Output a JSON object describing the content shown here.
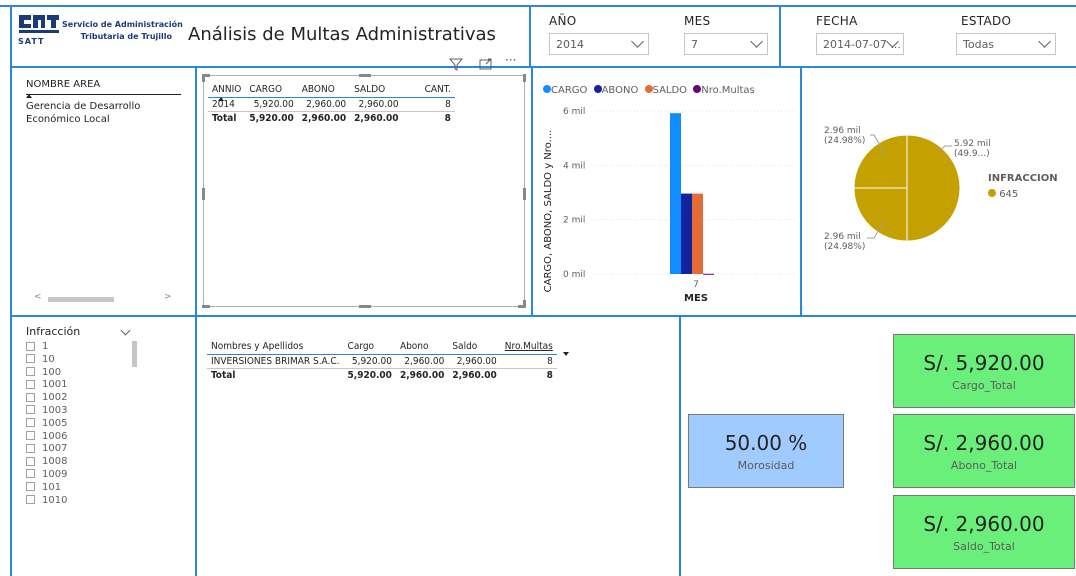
{
  "header": {
    "logo_letters": "SATT",
    "org_line1": "Servicio de Administración",
    "org_line2": "Tributaria de Trujillo",
    "title": "Análisis de Multas Administrativas"
  },
  "filters": [
    {
      "label": "AÑO",
      "value": "2014"
    },
    {
      "label": "MES",
      "value": "7"
    },
    {
      "label": "FECHA",
      "value": "2014-07-07 ..."
    },
    {
      "label": "ESTADO",
      "value": "Todas"
    }
  ],
  "area_slicer": {
    "header": "NOMBRE AREA",
    "items": [
      "Gerencia de Desarrollo Económico Local"
    ]
  },
  "summary_table": {
    "columns": [
      "ANNIO",
      "CARGO",
      "ABONO",
      "SALDO",
      "CANT."
    ],
    "rows": [
      [
        "2014",
        "5,920.00",
        "2,960.00",
        "2,960.00",
        "8"
      ]
    ],
    "total": [
      "Total",
      "5,920.00",
      "2,960.00",
      "2,960.00",
      "8"
    ]
  },
  "chart_data": [
    {
      "type": "bar",
      "legend": [
        "CARGO",
        "ABONO",
        "SALDO",
        "Nro.Multas"
      ],
      "ylabel": "CARGO, ABONO, SALDO y Nro....",
      "xlabel": "MES",
      "categories": [
        "7"
      ],
      "yticks": [
        "0 mil",
        "2 mil",
        "4 mil",
        "6 mil"
      ],
      "ylim": [
        0,
        6000
      ],
      "series": [
        {
          "name": "CARGO",
          "values": [
            5920
          ],
          "color": "#118dff"
        },
        {
          "name": "ABONO",
          "values": [
            2960
          ],
          "color": "#12239e"
        },
        {
          "name": "SALDO",
          "values": [
            2960
          ],
          "color": "#e66c37"
        },
        {
          "name": "Nro.Multas",
          "values": [
            8
          ],
          "color": "#6b007b"
        }
      ]
    },
    {
      "type": "pie",
      "legend_title": "INFRACCION",
      "legend": [
        "645"
      ],
      "color": "#c4a000",
      "slices": [
        {
          "value": 5920,
          "label": "5.92 mil",
          "pct": "(49.9...)"
        },
        {
          "value": 2960,
          "label": "2.96 mil",
          "pct": "(24.98%)"
        },
        {
          "value": 2960,
          "label": "2.96 mil",
          "pct": "(24.98%)"
        }
      ]
    }
  ],
  "infraccion_slicer": {
    "header": "Infracción",
    "items": [
      "1",
      "10",
      "100",
      "1001",
      "1002",
      "1003",
      "1005",
      "1006",
      "1007",
      "1008",
      "1009",
      "101",
      "1010"
    ]
  },
  "detail_table": {
    "columns": [
      "Nombres y Apellidos",
      "Cargo",
      "Abono",
      "Saldo",
      "Nro.Multas"
    ],
    "rows": [
      [
        "INVERSIONES BRIMAR S.A.C.",
        "5,920.00",
        "2,960.00",
        "2,960.00",
        "8"
      ]
    ],
    "total": [
      "Total",
      "5,920.00",
      "2,960.00",
      "2,960.00",
      "8"
    ]
  },
  "kpis": {
    "morosidad": {
      "value": "50.00 %",
      "label": "Morosidad",
      "color": "#a0cbff"
    },
    "cargo": {
      "value": "S/. 5,920.00",
      "label": "Cargo_Total",
      "color": "#6bef7b"
    },
    "abono": {
      "value": "S/. 2,960.00",
      "label": "Abono_Total",
      "color": "#6bef7b"
    },
    "saldo": {
      "value": "S/. 2,960.00",
      "label": "Saldo_Total",
      "color": "#6bef7b"
    }
  }
}
